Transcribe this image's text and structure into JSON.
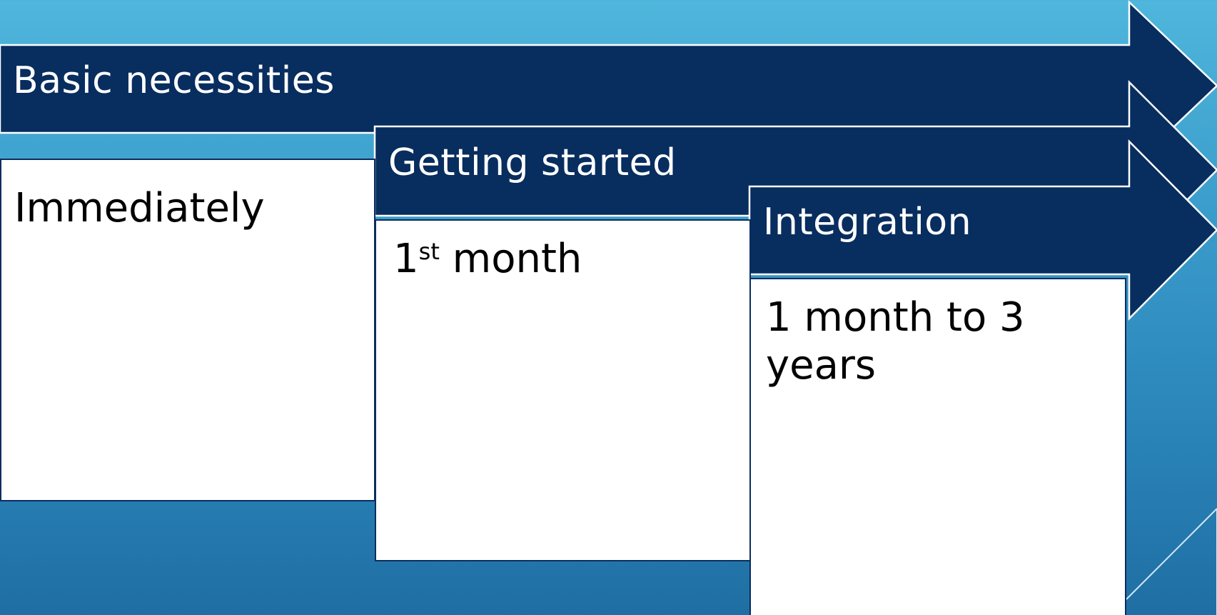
{
  "colors": {
    "background_top": "#4fb6dc",
    "background_bottom": "#1f6ea3",
    "arrow_fill": "#082d5f",
    "arrow_outline": "#ffffff",
    "box_fill": "#ffffff",
    "box_border": "#0b2d5e"
  },
  "stages": [
    {
      "label": "Basic necessities",
      "timeframe": "Immediately"
    },
    {
      "label": "Getting started",
      "timeframe_main": "1",
      "timeframe_sup": "st",
      "timeframe_rest": " month"
    },
    {
      "label": "Integration",
      "timeframe_line1": "1 month to 3",
      "timeframe_line2": "years"
    }
  ]
}
